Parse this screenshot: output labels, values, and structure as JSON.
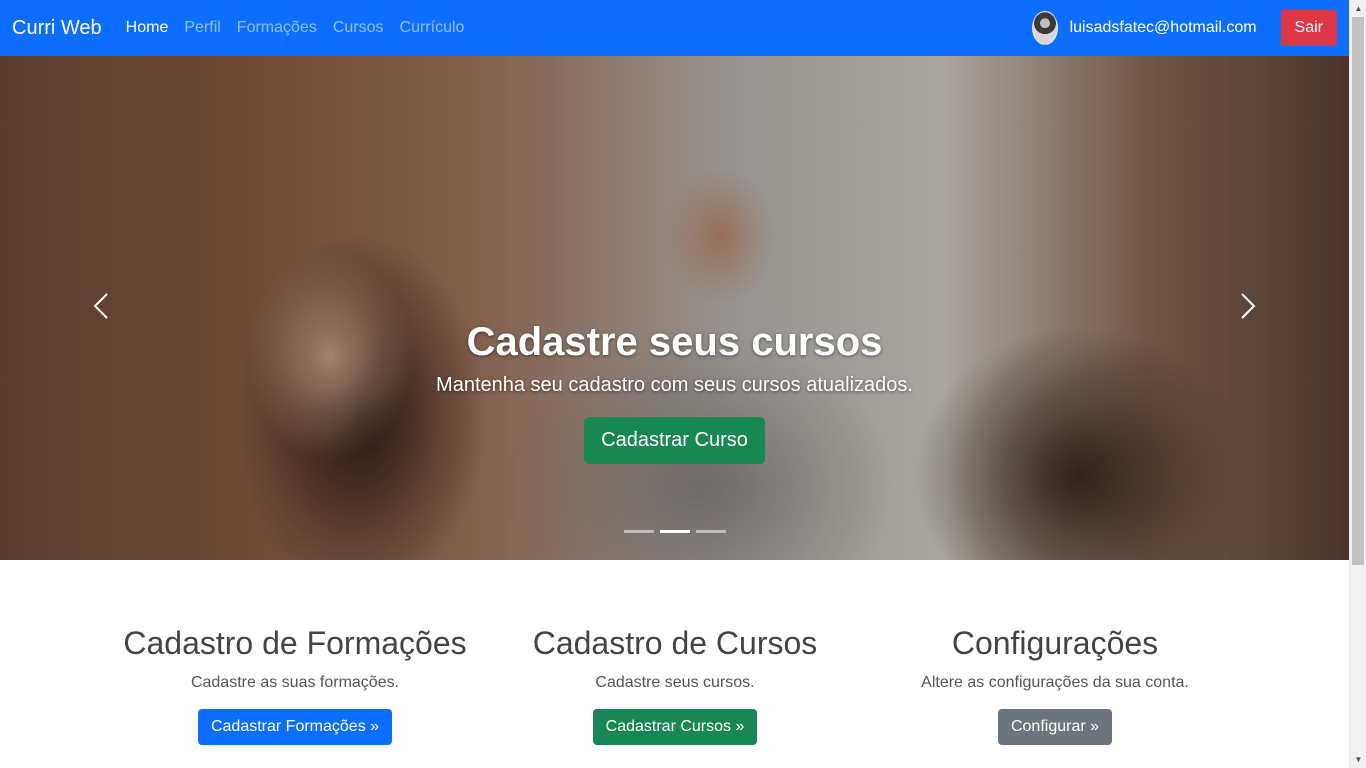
{
  "navbar": {
    "brand": "Curri Web",
    "links": [
      {
        "label": "Home",
        "active": true
      },
      {
        "label": "Perfil",
        "active": false
      },
      {
        "label": "Formações",
        "active": false
      },
      {
        "label": "Cursos",
        "active": false
      },
      {
        "label": "Currículo",
        "active": false
      }
    ],
    "user_email": "luisadsfatec@hotmail.com",
    "logout_label": "Sair",
    "avatar_icon": "user-avatar"
  },
  "carousel": {
    "title": "Cadastre seus cursos",
    "text": "Mantenha seu cadastro com seus cursos atualizados.",
    "button_label": "Cadastrar Curso",
    "prev_icon": "chevron-left-icon",
    "next_icon": "chevron-right-icon",
    "slide_count": 3,
    "active_slide": 2
  },
  "features": [
    {
      "title": "Cadastro de Formações",
      "description": "Cadastre as suas formações.",
      "button_label": "Cadastrar Formações »",
      "button_color": "#0d6efd"
    },
    {
      "title": "Cadastro de Cursos",
      "description": "Cadastre seus cursos.",
      "button_label": "Cadastrar Cursos »",
      "button_color": "#198754"
    },
    {
      "title": "Configurações",
      "description": "Altere as configurações da sua conta.",
      "button_label": "Configurar »",
      "button_color": "#6c757d"
    }
  ],
  "colors": {
    "navbar": "#0d6efd",
    "danger": "#dc3545",
    "success": "#198754",
    "secondary": "#6c757d"
  }
}
